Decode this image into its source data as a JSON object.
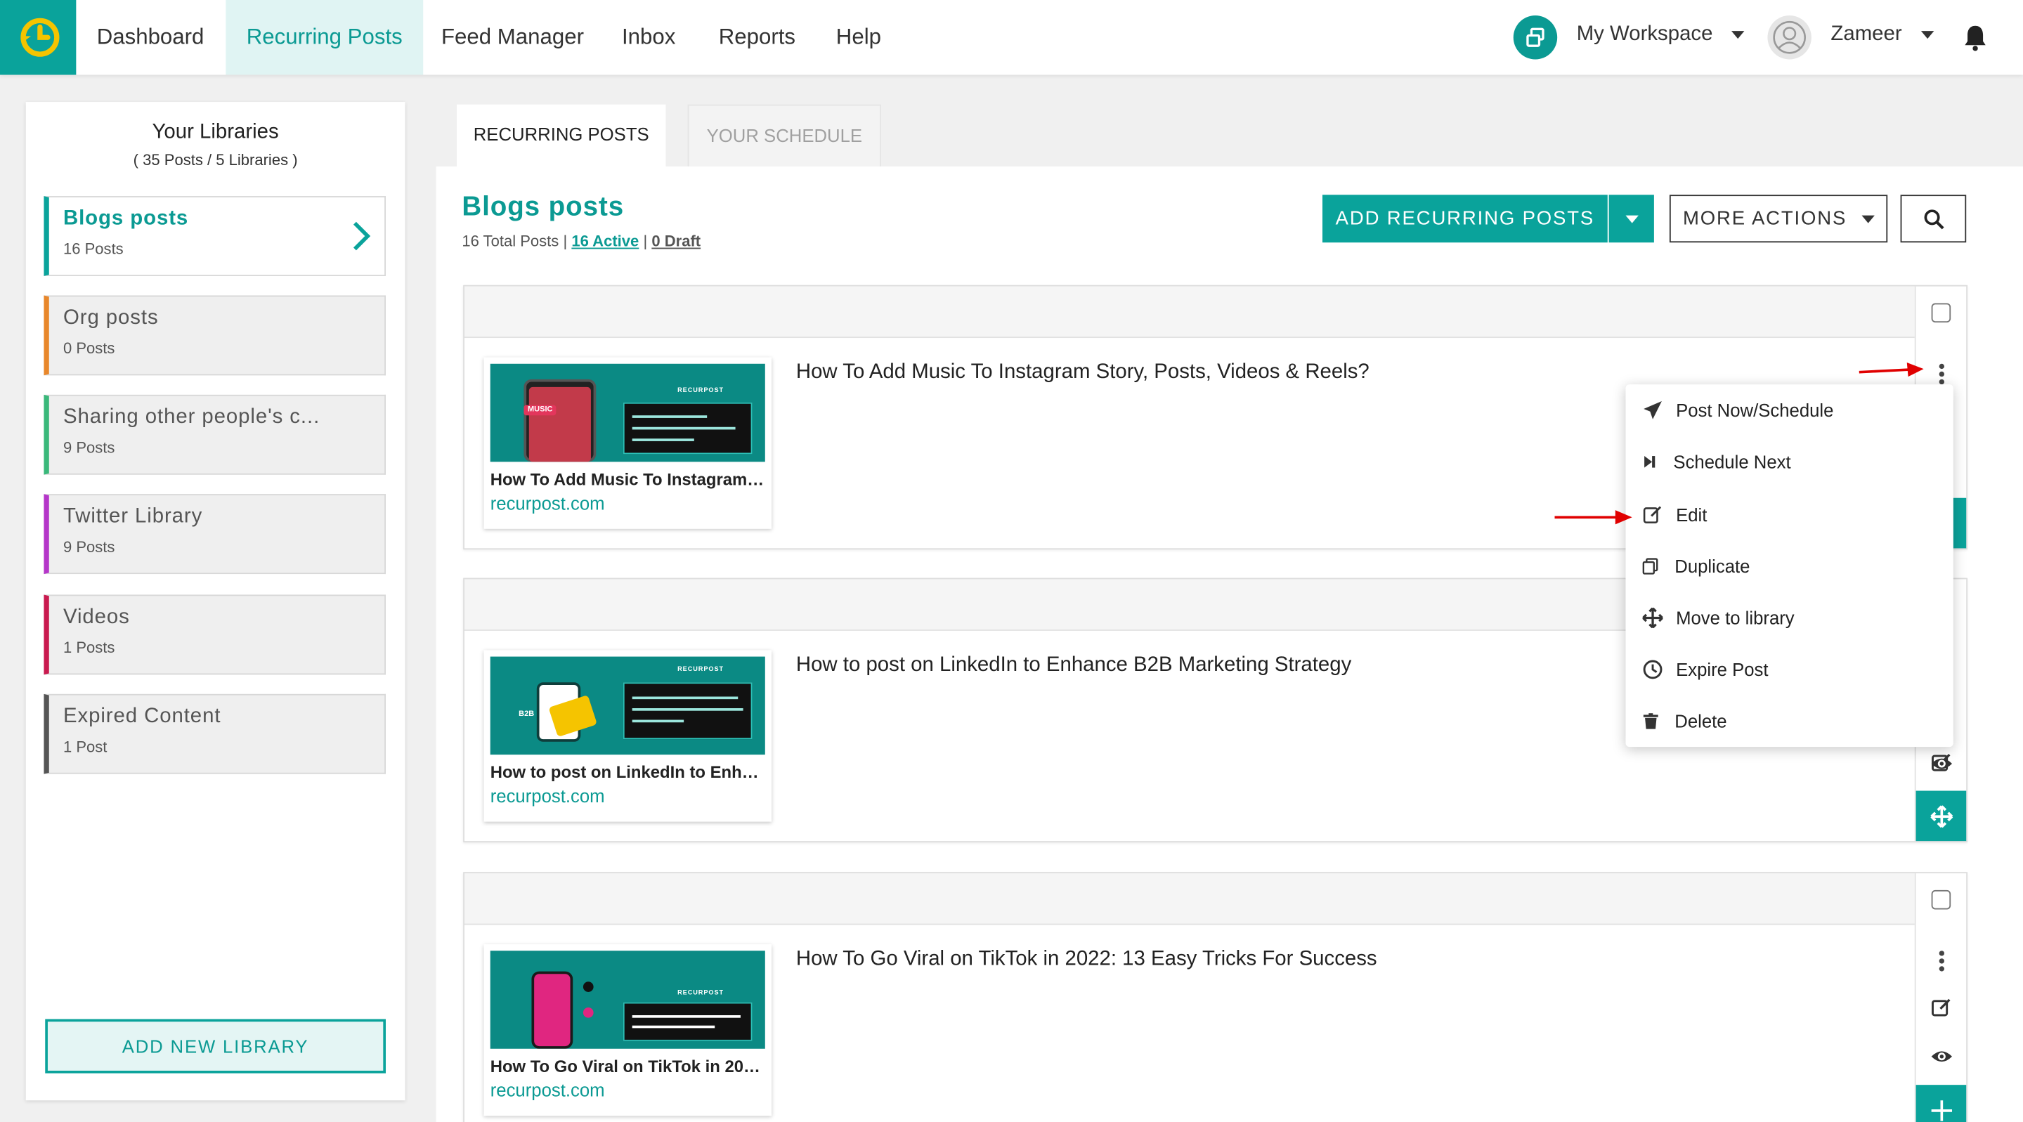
{
  "nav": {
    "items": [
      {
        "label": "Dashboard",
        "active": false
      },
      {
        "label": "Recurring Posts",
        "active": true
      },
      {
        "label": "Feed Manager",
        "active": false
      },
      {
        "label": "Inbox",
        "active": false
      },
      {
        "label": "Reports",
        "active": false
      },
      {
        "label": "Help",
        "active": false
      }
    ],
    "workspace": "My Workspace",
    "user": "Zameer"
  },
  "sidebar": {
    "title": "Your Libraries",
    "subtitle": "( 35 Posts / 5 Libraries )",
    "libraries": [
      {
        "name": "Blogs posts",
        "count": "16 Posts",
        "color": "#0aa39b"
      },
      {
        "name": "Org posts",
        "count": "0 Posts",
        "color": "#e8872b"
      },
      {
        "name": "Sharing other people's c...",
        "count": "9 Posts",
        "color": "#3ab87a"
      },
      {
        "name": "Twitter Library",
        "count": "9 Posts",
        "color": "#b536c9"
      },
      {
        "name": "Videos",
        "count": "1 Posts",
        "color": "#c91a4f"
      },
      {
        "name": "Expired Content",
        "count": "1 Post",
        "color": "#555555"
      }
    ],
    "add_label": "ADD NEW LIBRARY"
  },
  "tabs": {
    "active": "RECURRING POSTS",
    "inactive": "YOUR SCHEDULE"
  },
  "library": {
    "title": "Blogs posts",
    "total": "16 Total Posts",
    "sep": "|",
    "active": "16 Active",
    "draft": "0 Draft"
  },
  "actions": {
    "add": "ADD RECURRING POSTS",
    "more": "MORE ACTIONS"
  },
  "posts": [
    {
      "text": "How To Add Music To Instagram Story, Posts, Videos & Reels?",
      "preview_title": "How To Add Music To Instagram Story, Posts, Videos & Reels?",
      "domain": "recurpost.com",
      "thumb_tag": "MUSIC",
      "thumb_brand": "RECURPOST"
    },
    {
      "text": "How to post on LinkedIn to Enhance B2B Marketing Strategy",
      "preview_title": "How to post on LinkedIn to Enhance B2B Marketing Strategy",
      "domain": "recurpost.com",
      "thumb_tag": "B2B",
      "thumb_brand": "RECURPOST"
    },
    {
      "text": "How To Go Viral on TikTok in 2022: 13 Easy Tricks For Success",
      "preview_title": "How To Go Viral on TikTok in 2022: 13 Easy Tricks For Success",
      "domain": "recurpost.com",
      "thumb_tag": "",
      "thumb_brand": "RECURPOST"
    }
  ],
  "menu": {
    "items": [
      {
        "label": "Post Now/Schedule",
        "icon": "send-icon"
      },
      {
        "label": "Schedule Next",
        "icon": "skip-next-icon"
      },
      {
        "label": "Edit",
        "icon": "edit-icon"
      },
      {
        "label": "Duplicate",
        "icon": "copy-icon"
      },
      {
        "label": "Move to library",
        "icon": "move-icon"
      },
      {
        "label": "Expire Post",
        "icon": "clock-icon"
      },
      {
        "label": "Delete",
        "icon": "trash-icon"
      }
    ]
  },
  "colors": {
    "accent": "#0aa39b",
    "annotation_arrow": "#e00000"
  }
}
